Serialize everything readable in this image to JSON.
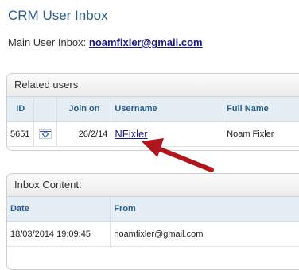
{
  "page": {
    "title": "CRM User Inbox"
  },
  "main_inbox": {
    "label": "Main User Inbox: ",
    "email": "noamfixler@gmail.com"
  },
  "related_users": {
    "header": "Related users",
    "columns": [
      "ID",
      "",
      "Join on",
      "Username",
      "Full Name"
    ],
    "rows": [
      {
        "id": "5651",
        "flag_icon": "israel-flag-icon",
        "join_on": "26/2/14",
        "username": "NFixler",
        "full_name": "Noam Fixler"
      }
    ]
  },
  "inbox_content": {
    "header": "Inbox Content:",
    "columns": [
      "Date",
      "From"
    ],
    "rows": [
      {
        "date": "18/03/2014 19:09:45",
        "from": "noamfixler@gmail.com"
      }
    ]
  },
  "annotation": {
    "icon": "red-arrow-icon",
    "color": "#b0161c"
  }
}
